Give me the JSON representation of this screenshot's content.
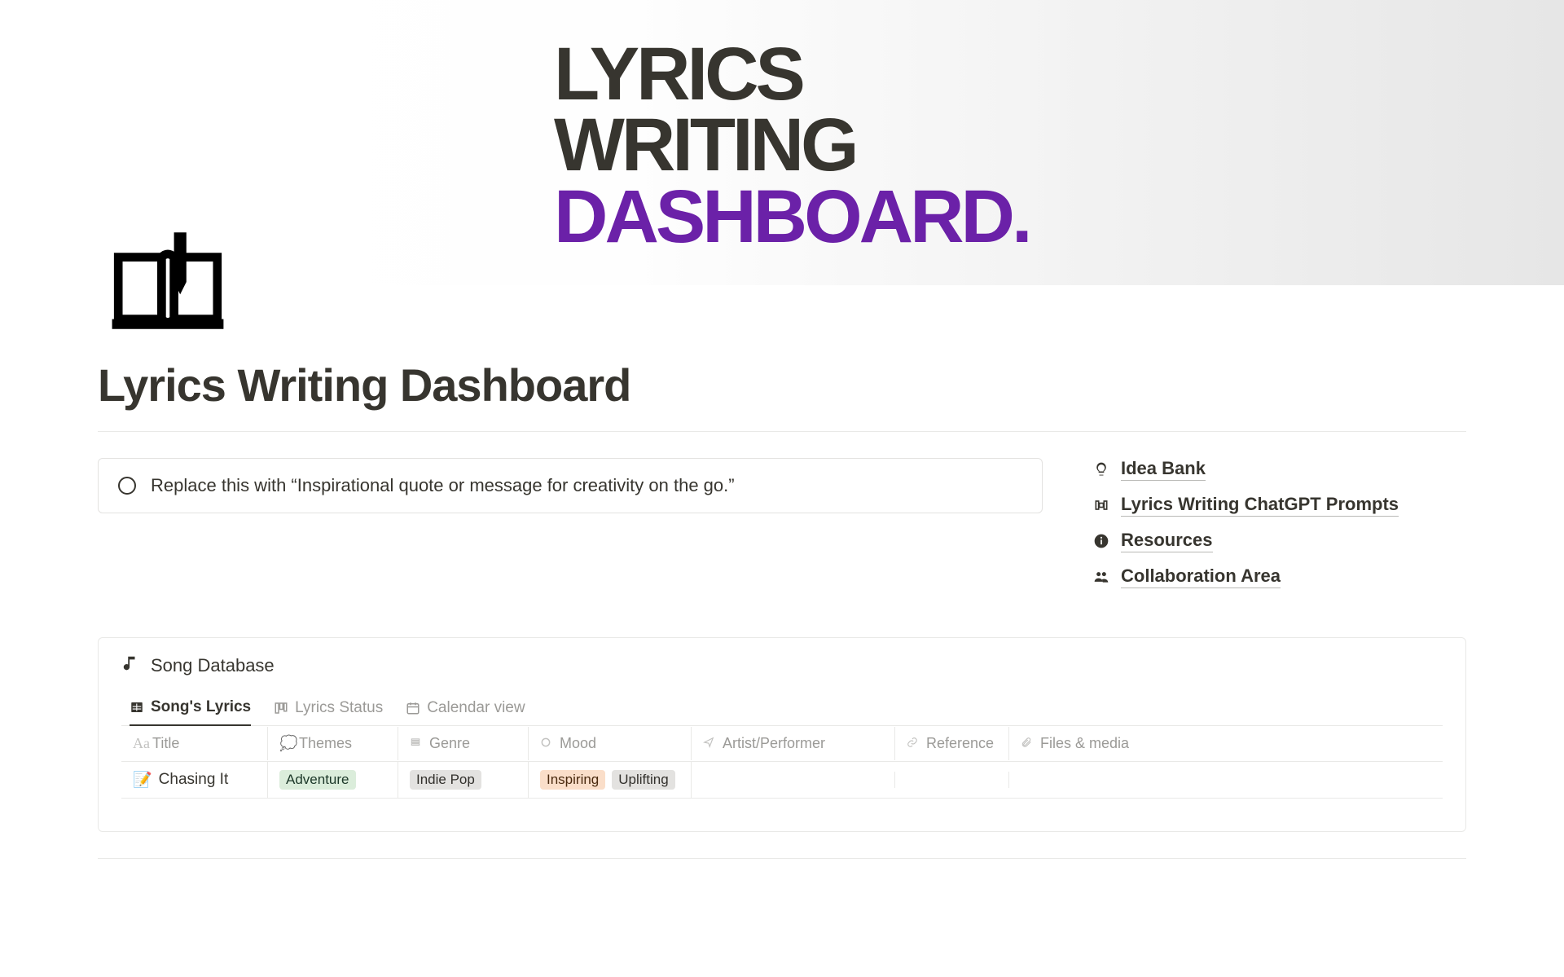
{
  "hero": {
    "line1": "LYRICS",
    "line2": "WRITING",
    "line3": "DASHBOARD."
  },
  "page_title": "Lyrics Writing Dashboard",
  "quote_placeholder": "Replace this with “Inspirational quote or message for creativity on the go.”",
  "nav": {
    "items": [
      {
        "label": "Idea Bank",
        "icon": "lightbulb-icon"
      },
      {
        "label": "Lyrics Writing ChatGPT Prompts",
        "icon": "form-icon"
      },
      {
        "label": "Resources",
        "icon": "info-icon"
      },
      {
        "label": "Collaboration Area",
        "icon": "people-icon"
      }
    ]
  },
  "database": {
    "title": "Song Database",
    "tabs": [
      {
        "label": "Song's Lyrics",
        "active": true,
        "icon": "table-icon"
      },
      {
        "label": "Lyrics Status",
        "active": false,
        "icon": "board-icon"
      },
      {
        "label": "Calendar view",
        "active": false,
        "icon": "calendar-icon"
      }
    ],
    "columns": [
      {
        "label": "Title",
        "icon": "Aa"
      },
      {
        "label": "Themes",
        "icon": "thought-icon"
      },
      {
        "label": "Genre",
        "icon": "stack-icon"
      },
      {
        "label": "Mood",
        "icon": "circle-icon"
      },
      {
        "label": "Artist/Performer",
        "icon": "send-icon"
      },
      {
        "label": "Reference",
        "icon": "link-icon"
      },
      {
        "label": "Files & media",
        "icon": "paperclip-icon"
      }
    ],
    "rows": [
      {
        "title_emoji": "📝",
        "title": "Chasing It",
        "themes": [
          {
            "text": "Adventure",
            "class": "tag-green"
          }
        ],
        "genre": [
          {
            "text": "Indie Pop",
            "class": "tag-grey"
          }
        ],
        "mood": [
          {
            "text": "Inspiring",
            "class": "tag-orange"
          },
          {
            "text": "Uplifting",
            "class": "tag-light"
          }
        ],
        "artist": "",
        "reference": "",
        "files": ""
      }
    ]
  }
}
